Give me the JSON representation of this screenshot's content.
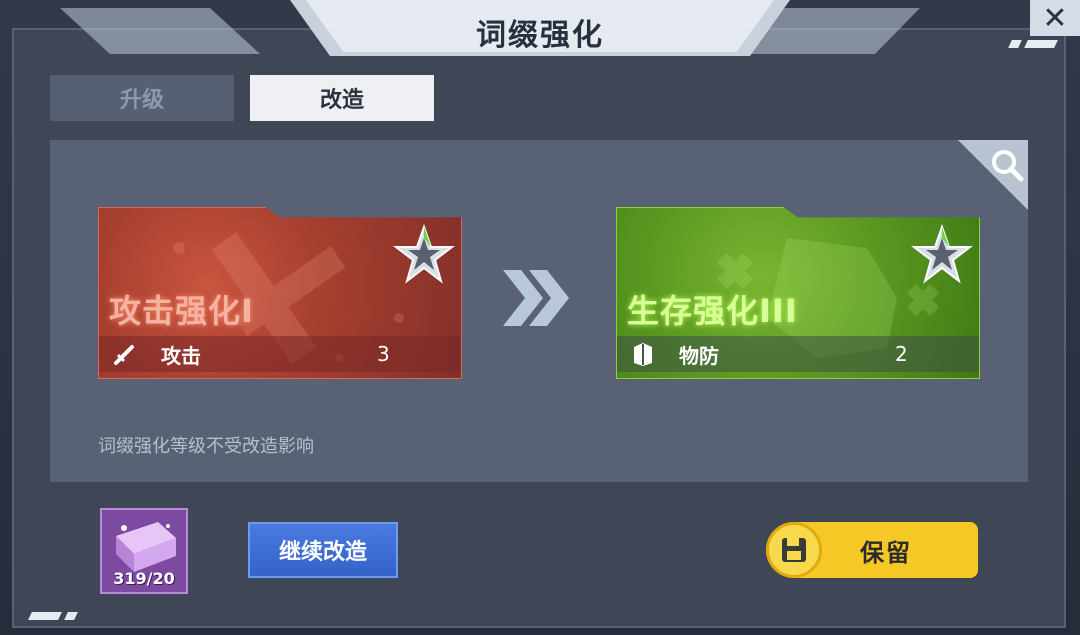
{
  "dialog": {
    "title": "词缀强化"
  },
  "tabs": [
    {
      "label": "升级",
      "active": false
    },
    {
      "label": "改造",
      "active": true
    }
  ],
  "current_affix": {
    "name": "攻击强化I",
    "stat_label": "攻击",
    "stat_value": "3",
    "stat_icon": "sword-icon",
    "color": "#a8402f"
  },
  "new_affix": {
    "name": "生存强化III",
    "stat_label": "物防",
    "stat_value": "2",
    "stat_icon": "armor-icon",
    "color": "#5c9a22"
  },
  "note": "词缀强化等级不受改造影响",
  "material": {
    "count": "319/20",
    "icon": "reforge-chest-icon"
  },
  "buttons": {
    "continue_label": "继续改造",
    "keep_label": "保留"
  },
  "colors": {
    "accent_yellow": "#f5c826",
    "accent_blue": "#3462c8",
    "panel": "#586274"
  }
}
